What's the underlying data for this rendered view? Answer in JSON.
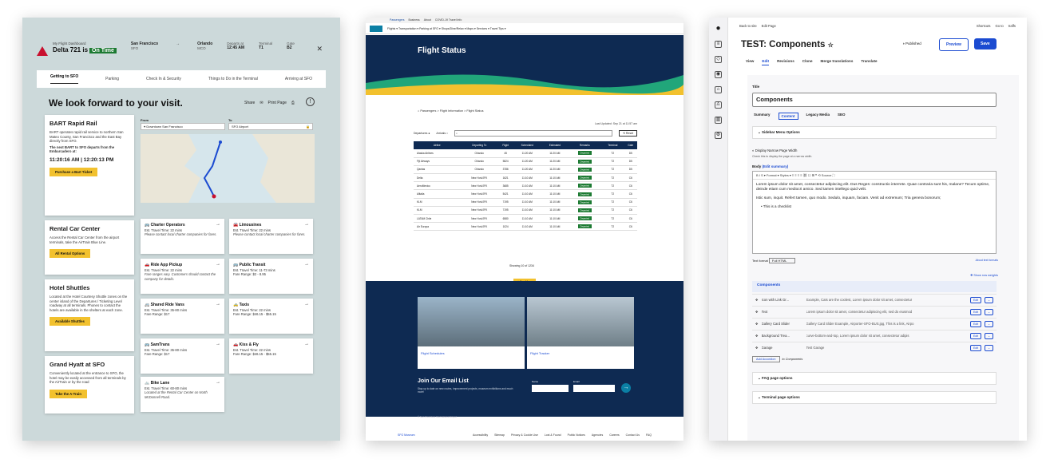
{
  "p1": {
    "dash_label": "My Flight Dashboard",
    "flight": "Delta 721 is",
    "status": "On Time",
    "from_city": "San Francisco",
    "from_code": "SFO",
    "to_city": "Orlando",
    "to_code": "MCO",
    "departs_label": "Departs at",
    "departs_time": "12:45 AM",
    "terminal_label": "Terminal",
    "terminal": "T1",
    "gate_label": "Gate",
    "gate": "B2",
    "tabs": [
      "Getting to SFO",
      "Parking",
      "Check In & Security",
      "Things to Do in the Terminal",
      "Arriving at SFO"
    ],
    "heading": "We look forward to your visit.",
    "share": "Share",
    "print": "Print Page",
    "bart": {
      "title": "BART Rapid Rail",
      "text": "BART operates rapid rail service to northern San Mateo County, San Francisco and the East Bay directly from SFO.",
      "next": "The next BART to SFO departs from the Embarcadero at:",
      "t1": "11:20:16 AM",
      "t2": "12:20:13 PM",
      "btn": "Purchase a Bart Ticket"
    },
    "rental": {
      "title": "Rental Car Center",
      "text": "Access the Rental Car Center from the airport terminals, take the AirTrain Blue Line.",
      "btn": "All Rental Options"
    },
    "shuttle": {
      "title": "Hotel Shuttles",
      "text": "Located at the Hotel Courtesy Shuttle zones on the center island of the Departures / Ticketing Level roadway at all terminals. Phones to contact the hotels are available in the shelters at each zone.",
      "btn": "Available Shuttles"
    },
    "hyatt": {
      "title": "Grand Hyatt at SFO",
      "text": "Conveniently located at the entrance to SFO, the hotel may be easily accessed from all terminals by the AirTrain or by the road",
      "btn": "Take the A-Train"
    },
    "map": {
      "from_label": "From",
      "from": "Downtown San Francisco",
      "to_label": "To",
      "to": "SFO Airport"
    },
    "transport": [
      {
        "name": "Charter Operators",
        "l1": "Est. Travel Time: 22 mins",
        "l2": "Please contact local charter companies for fares."
      },
      {
        "name": "Limousines",
        "l1": "Est. Travel Time: 22 mins",
        "l2": "Please contact local charter companies for fares."
      },
      {
        "name": "Ride App Pickup",
        "l1": "Est. Travel Time: 22 mins",
        "l2": "Fare ranges vary. Customers should contact the company for details."
      },
      {
        "name": "Public Transit",
        "l1": "Est. Travel Time: 11-73 mins",
        "l2": "Fare Range: $2 - 8.95"
      },
      {
        "name": "Shared Ride Vans",
        "l1": "Est. Travel Time: 35-80 mins",
        "l2": "Fare Range: $17"
      },
      {
        "name": "Taxis",
        "l1": "Est. Travel Time: 22 mins",
        "l2": "Fare Range: $46.15 - $55.15"
      },
      {
        "name": "SamTrans",
        "l1": "Est. Travel Time: 35-80 mins",
        "l2": "Fare Range: $17"
      },
      {
        "name": "Kiss & Fly",
        "l1": "Est. Travel Time: 22 mins",
        "l2": "Fare Range: $46.15 - $55.15"
      },
      {
        "name": "Bike Lane",
        "l1": "Est. Travel Time: 60-80 mins",
        "l2": "Located at the Rental Car Center on North McDonnell Road."
      }
    ]
  },
  "p2": {
    "topbar": [
      "Passengers",
      "Business",
      "About",
      "COVID-19 Travel Info"
    ],
    "nav": "Flights ▾   Transportation ▾   Parking at SFO ▾   Shops/Dine/Relax ▾   Maps ▾   Services ▾   Travel Tips ▾",
    "hero_title": "Flight Status",
    "crumb": "Passengers  >  Flight Information  >  Flight Status",
    "updated": "Last Updated: Sep 21 at 11:57 am",
    "columns": [
      "Airline",
      "Departing To",
      "Flight",
      "Scheduled",
      "Estimated",
      "Remarks",
      "Terminal",
      "Gate"
    ],
    "rows": [
      [
        "Alaska Airlines",
        "Orlando",
        "45",
        "11:20 AM",
        "11:20 AM",
        "Departed",
        "T2",
        "D5"
      ],
      [
        "Fiji Airways",
        "Orlando",
        "5824",
        "11:20 AM",
        "11:20 AM",
        "Departed",
        "T2",
        "D5"
      ],
      [
        "Qantas",
        "Orlando",
        "3786",
        "11:20 AM",
        "11:20 AM",
        "Departed",
        "T2",
        "D5"
      ],
      [
        "Delta",
        "New York/JFK",
        "1621",
        "11:10 AM",
        "11:10 AM",
        "Departed",
        "T2",
        "C6"
      ],
      [
        "AeroMexico",
        "New York/JFK",
        "3685",
        "11:10 AM",
        "11:10 AM",
        "Departed",
        "T2",
        "C6"
      ],
      [
        "Alitalia",
        "New York/JFK",
        "5421",
        "11:10 AM",
        "11:10 AM",
        "Departed",
        "T2",
        "C6"
      ],
      [
        "KLM",
        "New York/JFK",
        "7195",
        "11:10 AM",
        "11:10 AM",
        "Departed",
        "T2",
        "C6"
      ],
      [
        "KLM",
        "New York/JFK",
        "7195",
        "11:10 AM",
        "11:10 AM",
        "Departed",
        "T2",
        "C6"
      ],
      [
        "LATAM Chile",
        "New York/JFK",
        "6580",
        "11:10 AM",
        "11:10 AM",
        "Departed",
        "T2",
        "C6"
      ],
      [
        "Air Europa",
        "New York/JFK",
        "1024",
        "11:10 AM",
        "11:10 AM",
        "Departed",
        "T2",
        "C6"
      ]
    ],
    "showing": "Showing 10 of 1234",
    "see_more": "+ See More",
    "cards": [
      "Flight Schedules",
      "Flight Tracker"
    ],
    "email_title": "Join Our Email List",
    "email_text": "Stay up to date on new routes, improvement projects, museum exhibitions and much more!",
    "name_label": "Name",
    "email_label": "Email",
    "copyright": "© San Francisco International Airport",
    "footer": [
      "SFO Museum",
      "Accessibility",
      "Sitemap",
      "Privacy & Cookie Use",
      "Lost & Found",
      "Public Notices",
      "Agencies",
      "Careers",
      "Contact Us",
      "FAQ"
    ]
  },
  "p3": {
    "back": "Back to site",
    "edit_page": "Edit Page",
    "shortcuts": "Shortcuts",
    "goto": "Go to",
    "user": "traffs",
    "title": "TEST: Components",
    "published": "Published",
    "preview": "Preview",
    "save": "Save",
    "tabs": [
      "View",
      "Edit",
      "Revisions",
      "Clone",
      "Merge translations",
      "Translate"
    ],
    "title_label": "Title",
    "title_value": "Components",
    "subtabs": [
      "Summary",
      "Content",
      "Legacy Media",
      "SEO"
    ],
    "sidebar_menu": "Sidebar Menu Options",
    "narrow": "Display Narrow Page Width",
    "narrow_help": "Check this to display the page at a narrow width.",
    "body_label": "Body",
    "body_edit": "(Edit summary)",
    "body_p1": "Lorem ipsum dolor sit amet, consectetur adipiscing elit. Dus Reges: constructio interrete. Quae contraria sunt his, malane? Tecum optime, deinde etiam cum mediocri amico. Sed tamen intellego quid velit.",
    "body_p2": "Istic sum, inquit. Refert tamen, quo modo. Sedulo, inquam, faciam. Venit ad extremum; Tria genera bonorum;",
    "check1": "This is a checklist",
    "text_format": "Text format",
    "format_value": "Full HTML",
    "about_formats": "About text formats",
    "show_weights": "Show row weights",
    "components_label": "Components",
    "components": [
      {
        "name": "Icon with Link Gr...",
        "desc": "Example, Cats are the coolest, Lorem ipsum dolor sit amet, consectetur"
      },
      {
        "name": "Text",
        "desc": "Lorem ipsum dolor sit amet, consectetur adipiscing elit, sed do eiusmod"
      },
      {
        "name": "Gallery Card Slider",
        "desc": "Gallery Card Slider Example, Airporter-SFO-BUS.jpg, This is a link, Airpo"
      },
      {
        "name": "Background Trea...",
        "desc": "curve-bottom-and-top, Lorem ipsum dolor sit amet, consectetur adipis"
      },
      {
        "name": "Garage",
        "desc": "Test Garage"
      }
    ],
    "edit": "Edit",
    "add_accordion": "Add Accordion",
    "to_components": "to Components",
    "faq": "FAQ page options",
    "terminal": "Terminal page options"
  }
}
